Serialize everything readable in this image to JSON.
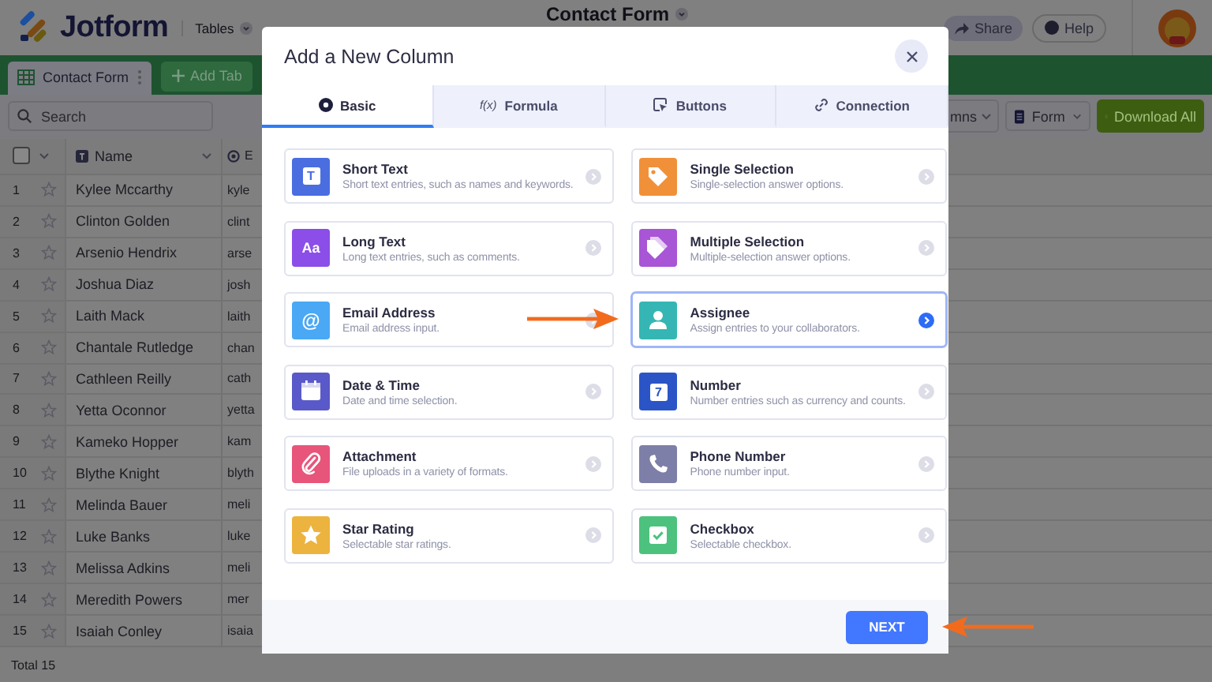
{
  "app": {
    "logo_text": "Jotform",
    "product": "Tables",
    "document_title": "Contact Form",
    "share": "Share",
    "help": "Help"
  },
  "sheet_tabs": [
    {
      "label": "Contact Form",
      "selected": true
    }
  ],
  "add_tab": "Add Tab",
  "toolbar": {
    "search": {
      "placeholder": "Search"
    },
    "columns_button": "mns",
    "form_button": "Form",
    "download_button": "Download All"
  },
  "table": {
    "select_all": {
      "checked": false
    },
    "columns": [
      "Name",
      "E"
    ],
    "rows": [
      {
        "number": "1",
        "starred": false,
        "name": "Kylee Mccarthy",
        "column_2": "kyle"
      },
      {
        "number": "2",
        "starred": false,
        "name": "Clinton Golden",
        "column_2": "clint"
      },
      {
        "number": "3",
        "starred": false,
        "name": "Arsenio Hendrix",
        "column_2": "arse"
      },
      {
        "number": "4",
        "starred": false,
        "name": "Joshua Diaz",
        "column_2": "josh"
      },
      {
        "number": "5",
        "starred": false,
        "name": "Laith Mack",
        "column_2": "laith"
      },
      {
        "number": "6",
        "starred": false,
        "name": "Chantale Rutledge",
        "column_2": "chan"
      },
      {
        "number": "7",
        "starred": false,
        "name": "Cathleen Reilly",
        "column_2": "cath"
      },
      {
        "number": "8",
        "starred": false,
        "name": "Yetta Oconnor",
        "column_2": "yetta"
      },
      {
        "number": "9",
        "starred": false,
        "name": "Kameko Hopper",
        "column_2": "kam"
      },
      {
        "number": "10",
        "starred": false,
        "name": "Blythe Knight",
        "column_2": "blyth"
      },
      {
        "number": "11",
        "starred": false,
        "name": "Melinda Bauer",
        "column_2": "meli"
      },
      {
        "number": "12",
        "starred": false,
        "name": "Luke Banks",
        "column_2": "luke"
      },
      {
        "number": "13",
        "starred": false,
        "name": "Melissa Adkins",
        "column_2": "meli"
      },
      {
        "number": "14",
        "starred": false,
        "name": "Meredith Powers",
        "column_2": "mer"
      },
      {
        "number": "15",
        "starred": false,
        "name": "Isaiah Conley",
        "column_2": "isaia"
      }
    ],
    "total": "Total 15"
  },
  "modal": {
    "title": "Add a New Column",
    "tabs": [
      {
        "label": "Basic",
        "selected": true
      },
      {
        "label": "Formula",
        "icon_text": "f(x)",
        "selected": false
      },
      {
        "label": "Buttons",
        "selected": false
      },
      {
        "label": "Connection",
        "selected": false
      }
    ],
    "column_types": [
      {
        "title": "Short Text",
        "description": "Short text entries, such as names and keywords.",
        "icon_label": "T",
        "color": "#4a6de0",
        "selected": false
      },
      {
        "title": "Single Selection",
        "description": "Single-selection answer options.",
        "color": "#f0913a",
        "selected": false
      },
      {
        "title": "Long Text",
        "description": "Long text entries, such as comments.",
        "icon_label": "Aa",
        "color": "#8b4ee8",
        "selected": false
      },
      {
        "title": "Multiple Selection",
        "description": "Multiple-selection answer options.",
        "color": "#a855d6",
        "selected": false
      },
      {
        "title": "Email Address",
        "description": "Email address input.",
        "icon_label": "@",
        "color": "#4aa8f5",
        "selected": false
      },
      {
        "title": "Assignee",
        "description": "Assign entries to your collaborators.",
        "color": "#35b6b4",
        "selected": true
      },
      {
        "title": "Date & Time",
        "description": "Date and time selection.",
        "color": "#5a59c9",
        "selected": false
      },
      {
        "title": "Number",
        "description": "Number entries such as currency and counts.",
        "icon_label": "7",
        "color": "#2b55c7",
        "selected": false
      },
      {
        "title": "Attachment",
        "description": "File uploads in a variety of formats.",
        "color": "#e8557a",
        "selected": false
      },
      {
        "title": "Phone Number",
        "description": "Phone number input.",
        "color": "#7d7fa8",
        "selected": false
      },
      {
        "title": "Star Rating",
        "description": "Selectable star ratings.",
        "color": "#ecb33e",
        "selected": false
      },
      {
        "title": "Checkbox",
        "description": "Selectable checkbox.",
        "color": "#4cc27e",
        "selected": false
      }
    ],
    "next_button": "NEXT"
  },
  "annotations": [
    {
      "kind": "arrow"
    },
    {
      "kind": "arrow"
    }
  ]
}
